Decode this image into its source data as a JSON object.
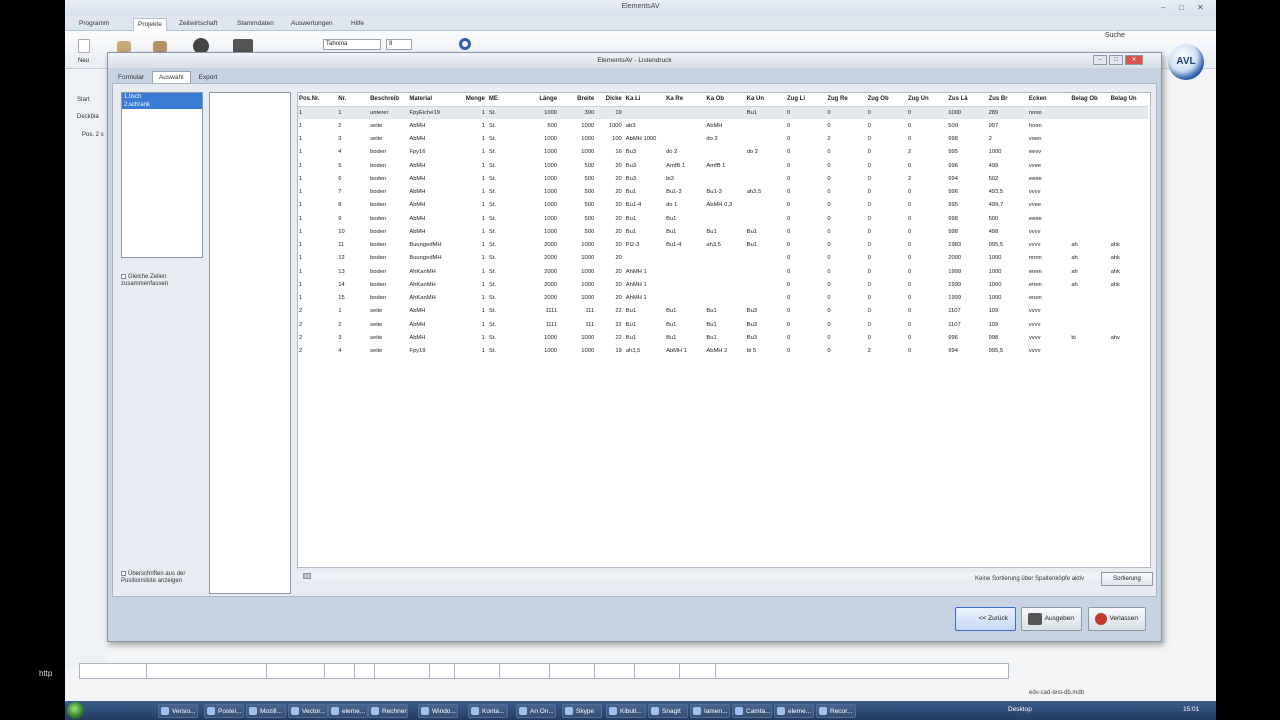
{
  "app": {
    "title": "ElementsAV",
    "search_label": "Suche",
    "logo_text": "AVL",
    "ribbon_tabs": [
      "Programm",
      "Projekte",
      "Zeitwirtschaft",
      "Stammdaten",
      "Auswertungen",
      "Hilfe"
    ],
    "active_ribbon_tab": "Projekte",
    "font_value": "Tahoma",
    "font_size_value": "8",
    "new_label": "Neu",
    "left_tabs": [
      "Start",
      "Deckbla",
      "Pos. 2 s"
    ],
    "bottom_db_file": "edv-cad-test-db.mdb",
    "http_label": "http"
  },
  "dialog": {
    "title": "ElementsAV - Listendruck",
    "tabs": [
      "Formular",
      "Auswahl",
      "Export"
    ],
    "active_tab": "Auswahl",
    "left_list": [
      "1.tisch",
      "2.schrank"
    ],
    "chk_merge": "Gleiche Zeilen zusammenfassen",
    "chk_headers": "Überschriften aus der Positionsliste anzeigen",
    "sort_hint": "Keine Sortierung über Spaltenköpfe aktiv",
    "sort_button": "Sortierung",
    "btn_back": "<< Zurück",
    "btn_output": "Ausgeben",
    "btn_leave": "Verlassen"
  },
  "grid": {
    "columns": [
      "Pos.Nr.",
      "Nr.",
      "Beschreib",
      "Material",
      "Menge",
      "ME",
      "Länge",
      "Breite",
      "Dicke",
      "Ka Li",
      "Ka Re",
      "Ka Ob",
      "Ka Un",
      "Zug Li",
      "Zug Re",
      "Zug Ob",
      "Zug Un",
      "Zus Lä",
      "Zus Br",
      "Ecken",
      "Belag Ob",
      "Belag Un"
    ],
    "rows": [
      [
        "1",
        "1",
        "unterer",
        "FpyEiche19",
        "1",
        "St.",
        "1000",
        "300",
        "19",
        "",
        "",
        "",
        "Bu1",
        "0",
        "0",
        "0",
        "0",
        "1000",
        "289",
        "nnoo",
        "",
        ""
      ],
      [
        "1",
        "2",
        "seite",
        "AbMH",
        "1",
        "St.",
        "500",
        "1000",
        "1000",
        "ab3",
        "",
        "AbMH",
        "",
        "0",
        "0",
        "0",
        "0",
        "500",
        "997",
        "hoen",
        "",
        ""
      ],
      [
        "1",
        "3",
        "seite",
        "AbMH",
        "1",
        "St.",
        "1000",
        "1000",
        "100",
        "AbMH 1000",
        "",
        "do 2",
        "",
        "0",
        "2",
        "0",
        "0",
        "998",
        "2",
        "voen",
        "",
        ""
      ],
      [
        "1",
        "4",
        "boden",
        "Fpy16",
        "1",
        "St.",
        "1000",
        "1000",
        "16",
        "Bu3",
        "do 2",
        "",
        "do 2",
        "0",
        "0",
        "0",
        "2",
        "995",
        "1000",
        "eevv",
        "",
        ""
      ],
      [
        "1",
        "5",
        "boden",
        "AbMH",
        "1",
        "St.",
        "1000",
        "500",
        "20",
        "Bu3",
        "AmfB 1",
        "AmfB 1",
        "",
        "0",
        "0",
        "0",
        "0",
        "996",
        "499",
        "vvee",
        "",
        ""
      ],
      [
        "1",
        "6",
        "boden",
        "AbMH",
        "1",
        "St.",
        "1000",
        "500",
        "20",
        "Bu3",
        "bi3",
        "",
        "",
        "0",
        "0",
        "0",
        "2",
        "994",
        "502",
        "eeee",
        "",
        ""
      ],
      [
        "1",
        "7",
        "boden",
        "AbMH",
        "1",
        "St.",
        "1000",
        "500",
        "20",
        "Bu1",
        "Bu1-3",
        "Bu1-3",
        "ah3,5",
        "0",
        "0",
        "0",
        "0",
        "996",
        "493,5",
        "vvvv",
        "",
        ""
      ],
      [
        "1",
        "8",
        "boden",
        "AbMH",
        "1",
        "St.",
        "1000",
        "500",
        "20",
        "Bu1-4",
        "do 1",
        "AbMH 0,3",
        "",
        "0",
        "0",
        "0",
        "0",
        "995",
        "499,7",
        "vvee",
        "",
        ""
      ],
      [
        "1",
        "9",
        "boden",
        "AbMH",
        "1",
        "St.",
        "1000",
        "500",
        "20",
        "Bu1",
        "Bu1",
        "",
        "",
        "0",
        "0",
        "0",
        "0",
        "998",
        "500",
        "eeee",
        "",
        ""
      ],
      [
        "1",
        "10",
        "boden",
        "AbMH",
        "1",
        "St.",
        "1000",
        "500",
        "20",
        "Bu1",
        "Bu1",
        "Bu1",
        "Bu1",
        "0",
        "0",
        "0",
        "0",
        "998",
        "498",
        "vvvv",
        "",
        ""
      ],
      [
        "1",
        "11",
        "boden",
        "BuungedMH",
        "1",
        "St.",
        "2000",
        "1000",
        "20",
        "Pi2-3",
        "Bu1-4",
        "ah3,5",
        "Bu1",
        "0",
        "0",
        "0",
        "0",
        "1983",
        "995,5",
        "vvvv",
        "ah",
        "ahk"
      ],
      [
        "1",
        "12",
        "boden",
        "BuungedMH",
        "1",
        "St.",
        "2000",
        "1000",
        "20",
        "",
        "",
        "",
        "",
        "0",
        "0",
        "0",
        "0",
        "2000",
        "1000",
        "nnnn",
        "ah",
        "ahk"
      ],
      [
        "1",
        "13",
        "boden",
        "AhKanMH",
        "1",
        "St.",
        "2000",
        "1000",
        "20",
        "AhMH 1",
        "",
        "",
        "",
        "0",
        "0",
        "0",
        "0",
        "1999",
        "1000",
        "enen",
        "ah",
        "ahk"
      ],
      [
        "1",
        "14",
        "boden",
        "AhKanMH",
        "1",
        "St.",
        "2000",
        "1000",
        "20",
        "AhMH 1",
        "",
        "",
        "",
        "0",
        "0",
        "0",
        "0",
        "1999",
        "1000",
        "enen",
        "ah",
        "ahk"
      ],
      [
        "1",
        "15",
        "boden",
        "AhKanMH",
        "1",
        "St.",
        "2000",
        "1000",
        "20",
        "AhMH 1",
        "",
        "",
        "",
        "0",
        "0",
        "0",
        "0",
        "1999",
        "1000",
        "enen",
        "",
        ""
      ],
      [
        "2",
        "1",
        "seite",
        "AbMH",
        "1",
        "St.",
        "1111",
        "111",
        "22",
        "Bu1",
        "Bu1",
        "Bu1",
        "Bu3",
        "0",
        "0",
        "0",
        "0",
        "1107",
        "109",
        "vvvv",
        "",
        ""
      ],
      [
        "2",
        "2",
        "seite",
        "AbMH",
        "1",
        "St.",
        "1111",
        "111",
        "22",
        "Bu1",
        "Bu1",
        "Bu1",
        "Bu3",
        "0",
        "0",
        "0",
        "0",
        "1107",
        "109",
        "vvvv",
        "",
        ""
      ],
      [
        "2",
        "3",
        "seite",
        "AbMH",
        "1",
        "St.",
        "1000",
        "1000",
        "22",
        "Bu1",
        "Bu1",
        "Bu1",
        "Bu3",
        "0",
        "0",
        "0",
        "0",
        "996",
        "998",
        "vvvv",
        "bi",
        "ahv"
      ],
      [
        "2",
        "4",
        "seite",
        "Fpy19",
        "1",
        "St.",
        "1000",
        "1000",
        "19",
        "ah3,5",
        "AbMH 1",
        "AbMH 2",
        "bi 5",
        "0",
        "0",
        "2",
        "0",
        "994",
        "995,5",
        "vvvv",
        "",
        ""
      ]
    ]
  },
  "taskbar": {
    "items": [
      "Versio...",
      "Postei...",
      "Mozill...",
      "Vector...",
      "eleme...",
      "Rechner",
      "Windo...",
      "Konta...",
      "An On...",
      "Skype",
      "Kibuti...",
      "SnagIt",
      "Iamen...",
      "Camta...",
      "eleme...",
      "Recor..."
    ],
    "desktop_label": "Desktop",
    "time": "15:01"
  }
}
